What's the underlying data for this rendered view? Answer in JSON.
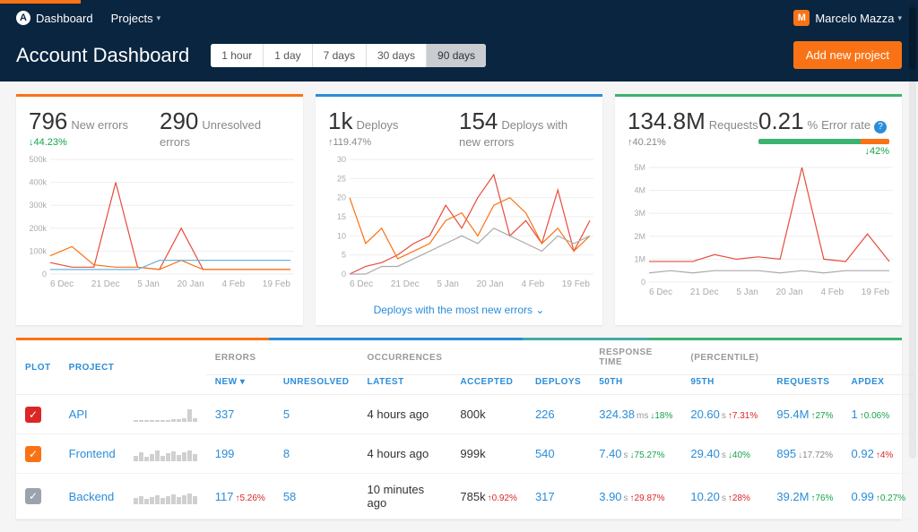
{
  "nav": {
    "dashboard": "Dashboard",
    "projects": "Projects",
    "username": "Marcelo Mazza"
  },
  "header": {
    "title": "Account Dashboard",
    "ranges": [
      "1 hour",
      "1 day",
      "7 days",
      "30 days",
      "90 days"
    ],
    "active_range": 4,
    "add_button": "Add new project"
  },
  "card1": {
    "v1": "796",
    "l1": "New errors",
    "d1": "44.23%",
    "v2": "290",
    "l2": "Unresolved errors"
  },
  "card2": {
    "v1": "1k",
    "l1": "Deploys",
    "d1": "119.47%",
    "v2": "154",
    "l2": "Deploys with new errors",
    "link": "Deploys with the most new errors"
  },
  "card3": {
    "v1": "134.8M",
    "l1": "Requests",
    "d1": "40.21%",
    "v2": "0.21",
    "u2": "%",
    "l2": "Error rate",
    "d2": "42%"
  },
  "x_axis": [
    "6 Dec",
    "21 Dec",
    "5 Jan",
    "20 Jan",
    "4 Feb",
    "19 Feb"
  ],
  "chart_data": [
    {
      "type": "line",
      "title": "New/Unresolved errors",
      "xlabel": "",
      "ylabel": "",
      "ylim": [
        0,
        500000
      ],
      "x": [
        "6 Dec",
        "21 Dec",
        "5 Jan",
        "20 Jan",
        "4 Feb",
        "19 Feb"
      ],
      "series": [
        {
          "name": "red",
          "values": [
            50000,
            30000,
            30000,
            400000,
            30000,
            20000,
            200000,
            20000,
            20000,
            20000,
            20000,
            20000
          ]
        },
        {
          "name": "orange",
          "values": [
            80000,
            120000,
            40000,
            30000,
            30000,
            20000,
            60000,
            20000,
            20000,
            20000,
            20000,
            20000
          ]
        },
        {
          "name": "blue",
          "values": [
            20000,
            20000,
            20000,
            20000,
            20000,
            60000,
            60000,
            60000,
            60000,
            60000,
            60000,
            60000
          ]
        }
      ]
    },
    {
      "type": "line",
      "title": "Deploys",
      "xlabel": "",
      "ylabel": "",
      "ylim": [
        0,
        30
      ],
      "x": [
        "6 Dec",
        "21 Dec",
        "5 Jan",
        "20 Jan",
        "4 Feb",
        "19 Feb"
      ],
      "series": [
        {
          "name": "red",
          "values": [
            0,
            2,
            3,
            5,
            8,
            10,
            18,
            12,
            20,
            26,
            10,
            14,
            8,
            22,
            6,
            14
          ]
        },
        {
          "name": "orange",
          "values": [
            20,
            8,
            12,
            4,
            6,
            8,
            14,
            16,
            10,
            18,
            20,
            16,
            8,
            12,
            6,
            10
          ]
        },
        {
          "name": "gray",
          "values": [
            0,
            0,
            2,
            2,
            4,
            6,
            8,
            10,
            8,
            12,
            10,
            8,
            6,
            10,
            8,
            10
          ]
        }
      ]
    },
    {
      "type": "line",
      "title": "Requests/Error rate",
      "xlabel": "",
      "ylabel": "",
      "ylim": [
        0,
        5000000
      ],
      "x": [
        "6 Dec",
        "21 Dec",
        "5 Jan",
        "20 Jan",
        "4 Feb",
        "19 Feb"
      ],
      "series": [
        {
          "name": "red",
          "values": [
            900000,
            900000,
            900000,
            1200000,
            1000000,
            1100000,
            1000000,
            5000000,
            1000000,
            900000,
            2100000,
            900000
          ]
        },
        {
          "name": "gray",
          "values": [
            400000,
            500000,
            400000,
            500000,
            500000,
            500000,
            400000,
            500000,
            400000,
            500000,
            500000,
            500000
          ]
        }
      ]
    }
  ],
  "table": {
    "headers": {
      "plot": "PLOT",
      "project": "PROJECT",
      "errors": "ERRORS",
      "new": "NEW",
      "unresolved": "UNRESOLVED",
      "occ": "OCCURRENCES",
      "latest": "LATEST",
      "accepted": "ACCEPTED",
      "deploys": "DEPLOYS",
      "rt": "RESPONSE TIME",
      "p50": "50TH",
      "pct": "(PERCENTILE)",
      "p95": "95TH",
      "requests": "REQUESTS",
      "apdex": "APDEX"
    },
    "rows": [
      {
        "color": "red",
        "project": "API",
        "spark": [
          2,
          2,
          2,
          2,
          2,
          2,
          2,
          3,
          3,
          4,
          14,
          4
        ],
        "new": "337",
        "new_d": "",
        "unresolved": "5",
        "latest": "4 hours ago",
        "accepted": "800k",
        "acc_d": "",
        "deploys": "226",
        "p50": "324.38",
        "p50u": "ms",
        "p50d": "18%",
        "p50c": "down-green2",
        "p95": "20.60",
        "p95u": "s",
        "p95d": "7.31%",
        "p95c": "up-red",
        "req": "95.4M",
        "req_d": "27%",
        "req_c": "up-green",
        "apdex": "1",
        "apdex_d": "0.06%",
        "apdex_c": "up-green"
      },
      {
        "color": "orange",
        "project": "Frontend",
        "spark": [
          6,
          10,
          5,
          8,
          12,
          6,
          9,
          11,
          7,
          10,
          12,
          8
        ],
        "new": "199",
        "new_d": "",
        "unresolved": "8",
        "latest": "4 hours ago",
        "accepted": "999k",
        "acc_d": "",
        "deploys": "540",
        "p50": "7.40",
        "p50u": "s",
        "p50d": "75.27%",
        "p50c": "down-green2",
        "p95": "29.40",
        "p95u": "s",
        "p95d": "40%",
        "p95c": "down-green2",
        "req": "895",
        "req_d": "17.72%",
        "req_c": "down-gray",
        "apdex": "0.92",
        "apdex_d": "4%",
        "apdex_c": "up-red"
      },
      {
        "color": "gray",
        "project": "Backend",
        "spark": [
          7,
          9,
          6,
          8,
          10,
          7,
          9,
          11,
          8,
          10,
          12,
          9
        ],
        "new": "117",
        "new_d": "5.26%",
        "new_c": "up-red",
        "unresolved": "58",
        "latest": "10 minutes ago",
        "accepted": "785k",
        "acc_d": "0.92%",
        "acc_c": "up-red",
        "deploys": "317",
        "p50": "3.90",
        "p50u": "s",
        "p50d": "29.87%",
        "p50c": "up-red",
        "p95": "10.20",
        "p95u": "s",
        "p95d": "28%",
        "p95c": "up-red",
        "req": "39.2M",
        "req_d": "76%",
        "req_c": "up-green",
        "apdex": "0.99",
        "apdex_d": "0.27%",
        "apdex_c": "up-green"
      }
    ]
  }
}
